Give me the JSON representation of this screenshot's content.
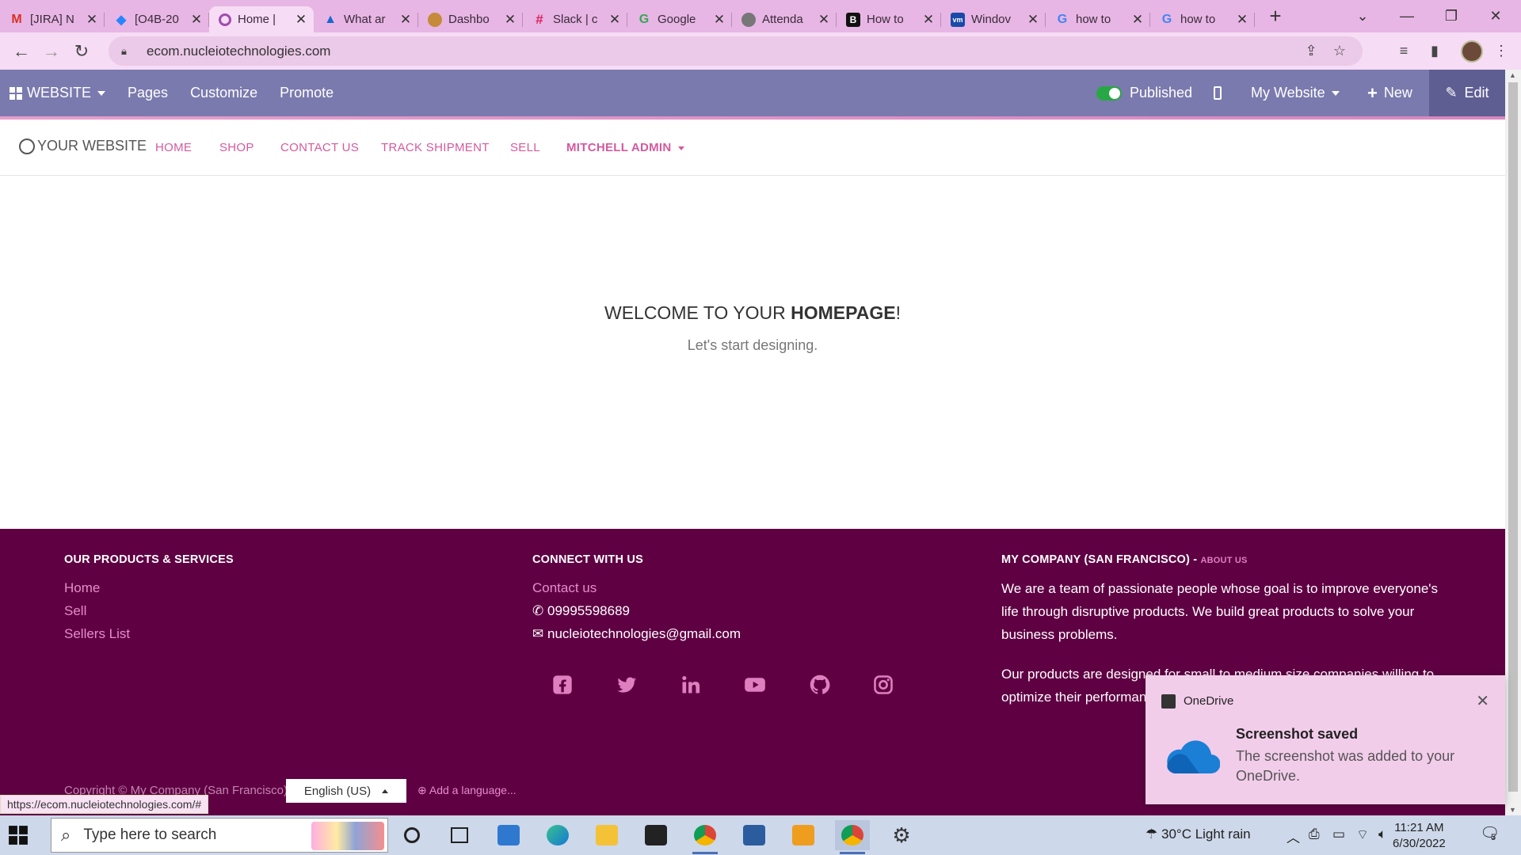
{
  "browser": {
    "tabs": [
      {
        "title": "[JIRA] N",
        "fav": "M",
        "color": "#d93025"
      },
      {
        "title": "[O4B-20",
        "fav": "◆",
        "color": "#2684ff"
      },
      {
        "title": "Home |",
        "fav": "○",
        "color": "#a04caf"
      },
      {
        "title": "What ar",
        "fav": "▲",
        "color": "#1967d2"
      },
      {
        "title": "Dashbo",
        "fav": "●",
        "color": "#c58a3a"
      },
      {
        "title": "Slack | c",
        "fav": "#",
        "color": "#4a154b"
      },
      {
        "title": "Google",
        "fav": "G",
        "color": "#34a853"
      },
      {
        "title": "Attenda",
        "fav": "◎",
        "color": "#666666"
      },
      {
        "title": "How to",
        "fav": "B",
        "color": "#111111"
      },
      {
        "title": "Windov",
        "fav": "v",
        "color": "#1a4aa8"
      },
      {
        "title": "how to",
        "fav": "G",
        "color": "#4285f4"
      },
      {
        "title": "how to",
        "fav": "G",
        "color": "#4285f4"
      }
    ],
    "url": "ecom.nucleiotechnologies.com",
    "status_url": "https://ecom.nucleiotechnologies.com/#"
  },
  "odoo_bar": {
    "website_menu": "WEBSITE",
    "pages": "Pages",
    "customize": "Customize",
    "promote": "Promote",
    "published": "Published",
    "my_website": "My Website",
    "new": "New",
    "edit": "Edit"
  },
  "site_header": {
    "logo": "YOUR WEBSITE",
    "nav": [
      "HOME",
      "SHOP",
      "CONTACT US",
      "TRACK SHIPMENT",
      "SELL",
      "MITCHELL ADMIN"
    ]
  },
  "hero": {
    "title_pre": "WELCOME TO YOUR ",
    "title_bold": "HOMEPAGE",
    "title_post": "!",
    "subtitle": "Let's start designing."
  },
  "footer": {
    "col1": {
      "heading": "OUR PRODUCTS & SERVICES",
      "links": [
        "Home",
        "Sell",
        "Sellers List"
      ]
    },
    "col2": {
      "heading": "CONNECT WITH US",
      "contact_link": "Contact us",
      "phone": "09995598689",
      "email": "nucleiotechnologies@gmail.com"
    },
    "col3": {
      "heading": "MY COMPANY (SAN FRANCISCO)",
      "heading_sep": " - ",
      "about_link": "ABOUT US",
      "para1": "We are a team of passionate people whose goal is to improve everyone's life through disruptive products. We build great products to solve your business problems.",
      "para2": "Our products are designed for small to medium size companies willing to optimize their performance."
    },
    "copyright": "Copyright © My Company (San Francisco)",
    "language": "English (US)",
    "add_language": "Add a language..."
  },
  "toast": {
    "app": "OneDrive",
    "title": "Screenshot saved",
    "body": "The screenshot was added to your OneDrive."
  },
  "taskbar": {
    "search_placeholder": "Type here to search",
    "weather": "30°C  Light rain",
    "time": "11:21 AM",
    "date": "6/30/2022",
    "notification_count": "5"
  },
  "colors": {
    "odoo_bar": "#7a7aae",
    "footer_bg": "#5f0043",
    "accent_pink": "#d45a9e",
    "published_green": "#28a745"
  }
}
